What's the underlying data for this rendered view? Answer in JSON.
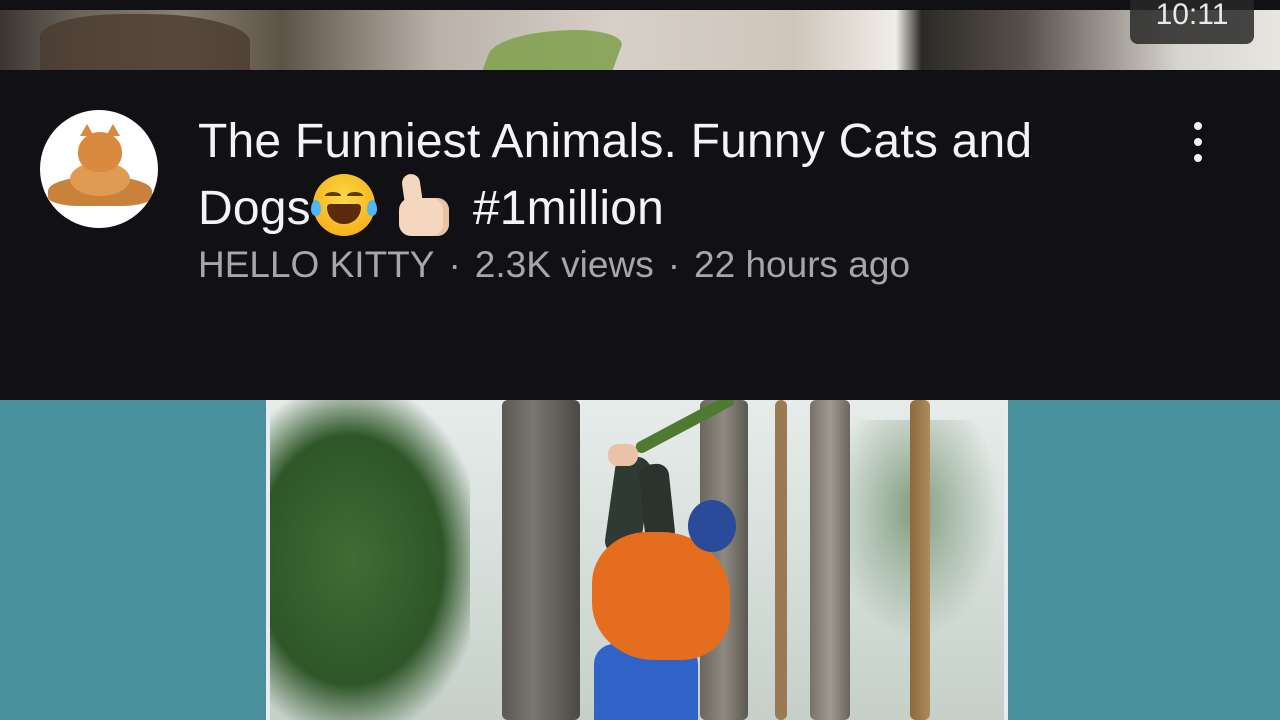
{
  "top_video": {
    "duration": "10:11"
  },
  "video": {
    "title_line1": "The Funniest Animals. Funny Cats and",
    "title_word": "Dogs",
    "title_emojis": [
      "😂",
      "👍🏻"
    ],
    "title_hashtag": "#1million",
    "channel": "HELLO KITTY",
    "views": "2.3K views",
    "age": "22 hours ago",
    "separator": "·",
    "avatar_icon": "cats-avatar-icon",
    "menu_icon": "more-vert-icon"
  },
  "colors": {
    "background": "#111014",
    "title_text": "#f4f4f4",
    "meta_text": "#a7a7a7",
    "thumbnail_bg": "#4a8f9c"
  }
}
